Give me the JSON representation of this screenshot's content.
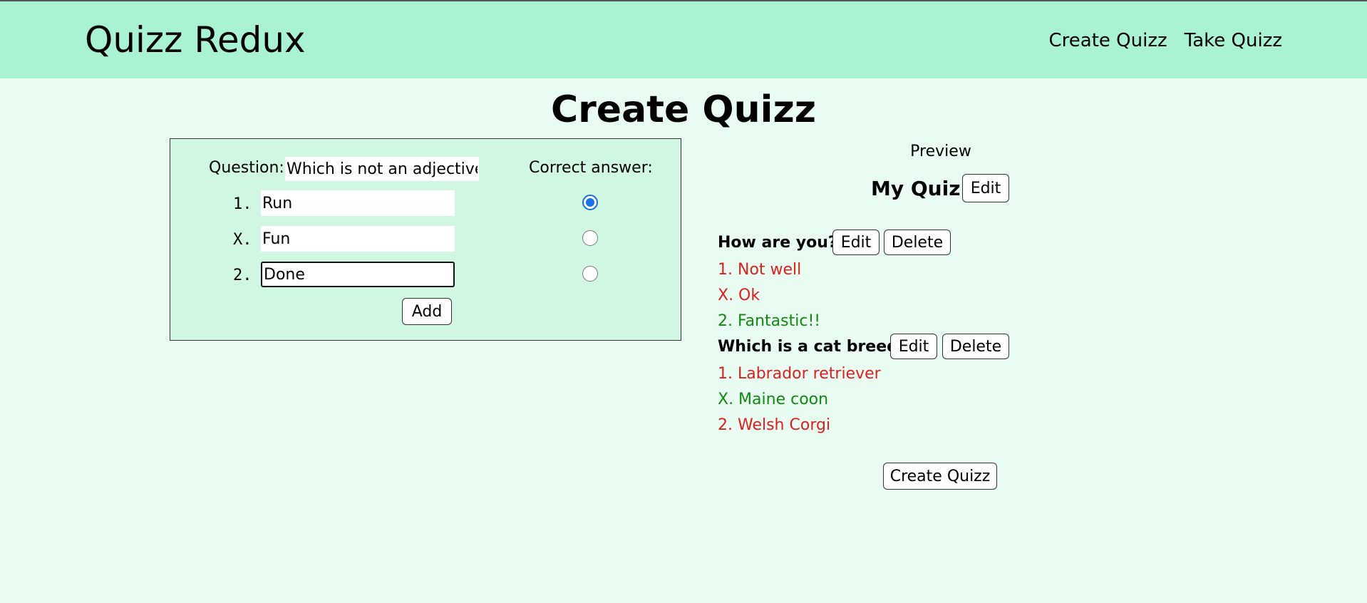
{
  "header": {
    "brand": "Quizz Redux",
    "nav": [
      "Create Quizz",
      "Take Quizz"
    ]
  },
  "page_title": "Create Quizz",
  "editor": {
    "question_label": "Question:",
    "question_value": "Which is not an adjective?",
    "correct_label": "Correct answer:",
    "answers": [
      {
        "number": "1.",
        "value": "Run",
        "checked": true
      },
      {
        "number": "X.",
        "value": "Fun",
        "checked": false
      },
      {
        "number": "2.",
        "value": "Done",
        "checked": false
      }
    ],
    "add_label": "Add"
  },
  "preview": {
    "label": "Preview",
    "quiz_name": "My Quiz",
    "edit_label": "Edit",
    "delete_label": "Delete",
    "questions": [
      {
        "title": "How are you?",
        "answers": [
          {
            "text": "1. Not well",
            "correct": false
          },
          {
            "text": "X. Ok",
            "correct": false
          },
          {
            "text": "2. Fantastic!!",
            "correct": true
          }
        ]
      },
      {
        "title": "Which is a cat breed?",
        "answers": [
          {
            "text": "1. Labrador retriever",
            "correct": false
          },
          {
            "text": "X. Maine coon",
            "correct": true
          },
          {
            "text": "2. Welsh Corgi",
            "correct": false
          }
        ]
      }
    ],
    "create_label": "Create Quizz"
  },
  "colors": {
    "header_bg": "#a9f3d2",
    "page_bg": "#e8fcf2",
    "editor_bg": "#d0f7e2",
    "wrong": "#e02020",
    "correct": "#108a10",
    "radio_checked": "#1a73e8"
  }
}
